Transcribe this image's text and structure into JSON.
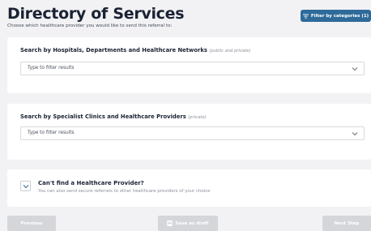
{
  "header": {
    "title": "Directory of Services",
    "subtitle": "Choose which healthcare provider you would like to send this referral to:",
    "filter_button": "Filter by categories (1)"
  },
  "sections": [
    {
      "title": "Search by Hospitals, Departments and Healthcare Networks",
      "note": "(public and private)",
      "placeholder": "Type to filter results"
    },
    {
      "title": "Search by Specialist Clinics and Healthcare Providers",
      "note": "(private)",
      "placeholder": "Type to filter results"
    }
  ],
  "not_found": {
    "title": "Can't find a Healthcare Provider?",
    "subtitle": "You can also send secure referrals to other healthcare providers of your choice"
  },
  "footer": {
    "previous": "Previous",
    "save_draft": "Save as draft",
    "next": "Next Step"
  },
  "colors": {
    "accent": "#2f6b9a",
    "background": "#f2f2f4",
    "disabled_button": "#d5d6da"
  },
  "icons": {
    "filter": "filter-icon",
    "select_chevron": "chevron-down-icon",
    "expander": "chevron-down-icon",
    "save": "floppy-disk-icon"
  }
}
